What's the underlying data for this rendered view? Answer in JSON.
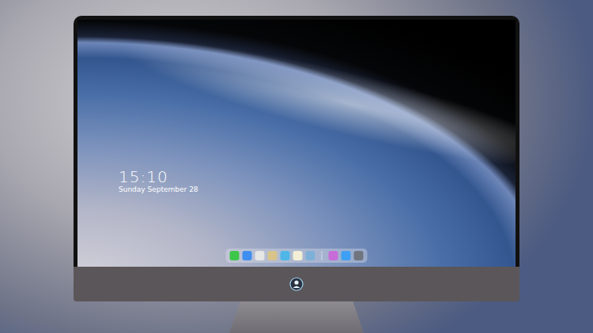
{
  "screen": {
    "clock": {
      "time": "15:10",
      "date": "Sunday September 28"
    }
  },
  "dock": {
    "groups": [
      {
        "items": [
          {
            "color": "#3ec64a"
          },
          {
            "color": "#3f8ef0"
          },
          {
            "color": "#e6e6e6"
          },
          {
            "color": "#d8c48a"
          },
          {
            "color": "#4fb6e8"
          },
          {
            "color": "#f3efd6"
          },
          {
            "color": "#7fb1d8"
          }
        ]
      },
      {
        "items": [
          {
            "color": "#c86cd8"
          },
          {
            "color": "#3da0f5"
          },
          {
            "color": "#707580"
          }
        ]
      }
    ]
  }
}
